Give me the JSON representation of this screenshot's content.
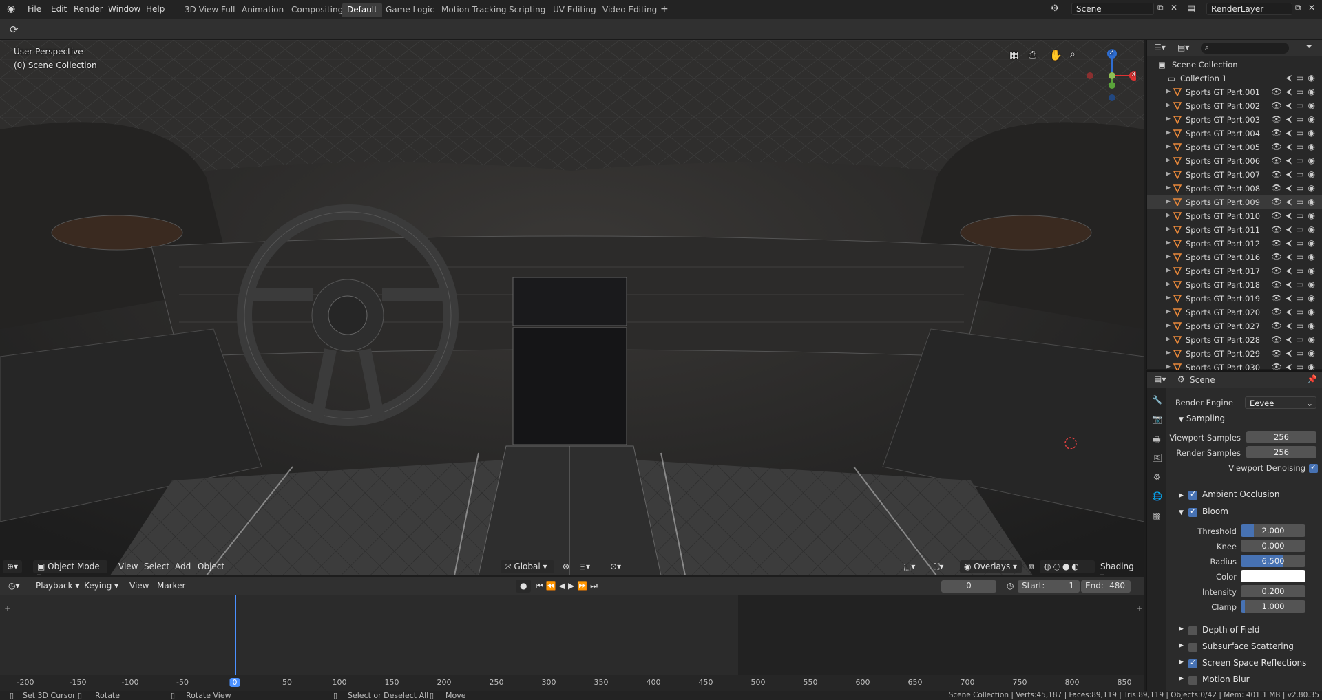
{
  "menu": [
    "File",
    "Edit",
    "Render",
    "Window",
    "Help"
  ],
  "workspaces": [
    {
      "label": "3D View Full",
      "active": false
    },
    {
      "label": "Animation",
      "active": false
    },
    {
      "label": "Compositing",
      "active": false
    },
    {
      "label": "Default",
      "active": true
    },
    {
      "label": "Game Logic",
      "active": false
    },
    {
      "label": "Motion Tracking",
      "active": false
    },
    {
      "label": "Scripting",
      "active": false
    },
    {
      "label": "UV Editing",
      "active": false
    },
    {
      "label": "Video Editing",
      "active": false
    }
  ],
  "add_tab": "+",
  "scene_name": "Scene",
  "render_layer": "RenderLayer",
  "viewport": {
    "perspective": "User Perspective",
    "collection": "(0) Scene Collection",
    "mode": "Object Mode",
    "menus": [
      "View",
      "Select",
      "Add",
      "Object"
    ],
    "orientation": "Global",
    "overlays": "Overlays",
    "shading": "Shading",
    "gizmo": {
      "z": "Z",
      "x": "X"
    }
  },
  "timeline": {
    "menus": [
      "Playback",
      "Keying",
      "View",
      "Marker"
    ],
    "current_frame": "0",
    "start_label": "Start:",
    "start": "1",
    "end_label": "End:",
    "end": "480",
    "ruler": [
      "-200",
      "-150",
      "-100",
      "-50",
      "0",
      "50",
      "100",
      "150",
      "200",
      "250",
      "300",
      "350",
      "400",
      "450",
      "500",
      "550",
      "600",
      "650",
      "700",
      "750",
      "800",
      "850"
    ]
  },
  "outliner": {
    "root": "Scene Collection",
    "collection": "Collection 1",
    "items": [
      "Sports GT Part.001",
      "Sports GT Part.002",
      "Sports GT Part.003",
      "Sports GT Part.004",
      "Sports GT Part.005",
      "Sports GT Part.006",
      "Sports GT Part.007",
      "Sports GT Part.008",
      "Sports GT Part.009",
      "Sports GT Part.010",
      "Sports GT Part.011",
      "Sports GT Part.012",
      "Sports GT Part.016",
      "Sports GT Part.017",
      "Sports GT Part.018",
      "Sports GT Part.019",
      "Sports GT Part.020",
      "Sports GT Part.027",
      "Sports GT Part.028",
      "Sports GT Part.029",
      "Sports GT Part.030"
    ],
    "selected_index": 8
  },
  "properties": {
    "context": "Scene",
    "render_engine_label": "Render Engine",
    "render_engine": "Eevee",
    "sampling": "Sampling",
    "viewport_samples_label": "Viewport Samples",
    "viewport_samples": "256",
    "render_samples_label": "Render Samples",
    "render_samples": "256",
    "viewport_denoising": "Viewport Denoising",
    "ambient_occlusion": "Ambient Occlusion",
    "bloom": "Bloom",
    "bloom_fields": [
      {
        "label": "Threshold",
        "value": "2.000",
        "fill": 0.2
      },
      {
        "label": "Knee",
        "value": "0.000",
        "fill": 0
      },
      {
        "label": "Radius",
        "value": "6.500",
        "fill": 0.65
      },
      {
        "label": "Color",
        "value": "",
        "fill": 0
      },
      {
        "label": "Intensity",
        "value": "0.200",
        "fill": 0
      },
      {
        "label": "Clamp",
        "value": "1.000",
        "fill": 0.03
      }
    ],
    "sections": [
      {
        "label": "Depth of Field",
        "checked": false
      },
      {
        "label": "Subsurface Scattering",
        "checked": false
      },
      {
        "label": "Screen Space Reflections",
        "checked": true
      },
      {
        "label": "Motion Blur",
        "checked": false
      }
    ]
  },
  "status": {
    "set_cursor": "Set 3D Cursor",
    "rotate": "Rotate",
    "rotate_view": "Rotate View",
    "select": "Select or Deselect All",
    "move": "Move",
    "stats": "Scene Collection | Verts:45,187 | Faces:89,119 | Tris:89,119 | Objects:0/42 | Mem: 401.1 MB | v2.80.35"
  }
}
